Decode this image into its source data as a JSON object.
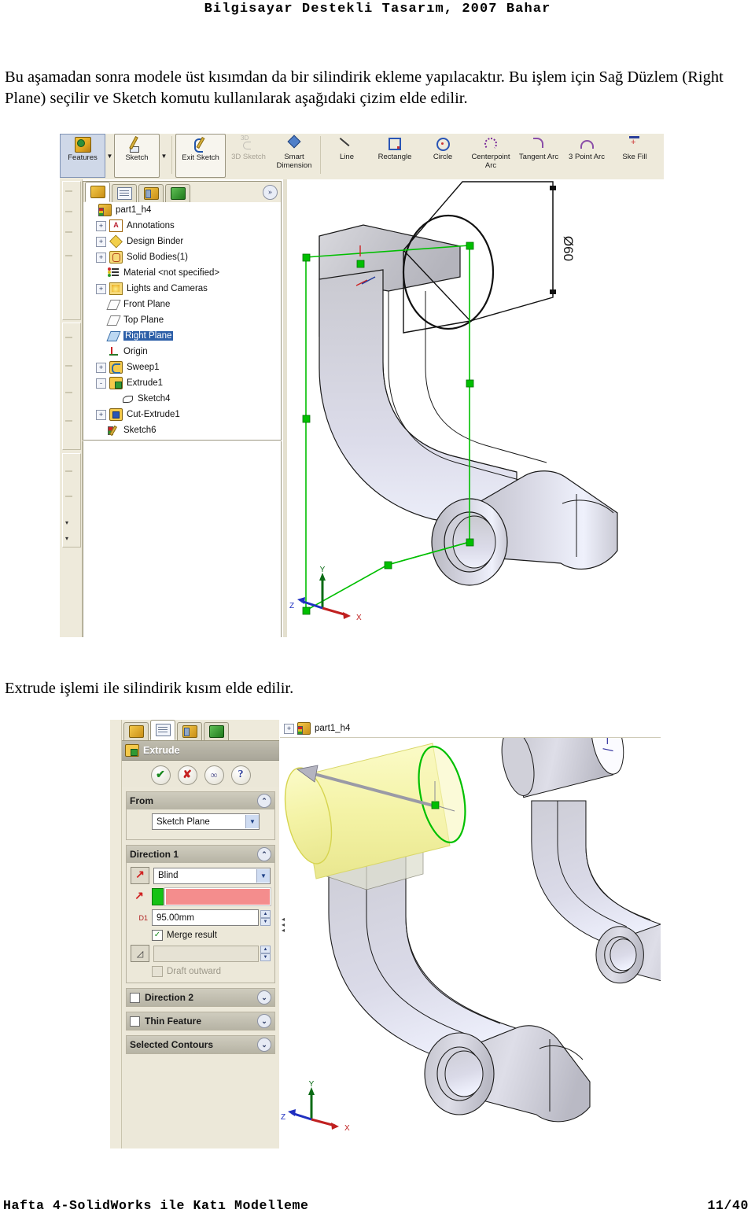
{
  "document": {
    "header": "Bilgisayar Destekli Tasarım, 2007 Bahar",
    "paragraph1": "Bu aşamadan sonra modele üst kısımdan da bir silindirik ekleme yapılacaktır. Bu işlem için Sağ Düzlem (Right Plane) seçilir ve Sketch komutu kullanılarak aşağıdaki çizim elde edilir.",
    "paragraph2": "Extrude işlemi ile silindirik kısım elde edilir.",
    "footer_left": "Hafta 4-SolidWorks ile Katı Modelleme",
    "footer_right": "11/40"
  },
  "screenshot1": {
    "toolbar": [
      {
        "label": "Features",
        "icon": "features-icon",
        "has_dropdown": true,
        "state": "active"
      },
      {
        "label": "Sketch",
        "icon": "sketch-icon",
        "has_dropdown": true,
        "state": "framed"
      },
      {
        "label": "Exit Sketch",
        "icon": "exit-sketch-icon",
        "state": "framed"
      },
      {
        "label": "3D Sketch",
        "icon": "3d-sketch-icon",
        "state": "disabled"
      },
      {
        "label": "Smart Dimension",
        "icon": "smart-dimension-icon",
        "state": "normal"
      },
      {
        "label": "Line",
        "icon": "line-icon",
        "state": "normal"
      },
      {
        "label": "Rectangle",
        "icon": "rectangle-icon",
        "state": "normal"
      },
      {
        "label": "Circle",
        "icon": "circle-icon",
        "state": "normal"
      },
      {
        "label": "Centerpoint Arc",
        "icon": "centerpoint-arc-icon",
        "state": "normal"
      },
      {
        "label": "Tangent Arc",
        "icon": "tangent-arc-icon",
        "state": "normal"
      },
      {
        "label": "3 Point Arc",
        "icon": "3-point-arc-icon",
        "state": "normal"
      },
      {
        "label": "Ske Fill",
        "icon": "sketch-fillet-icon",
        "state": "clipped"
      }
    ],
    "tree_tabs": [
      {
        "name": "feature-manager-tab",
        "icon": "feature-tree-icon",
        "selected": true
      },
      {
        "name": "property-manager-tab",
        "icon": "property-clipboard-icon",
        "selected": false
      },
      {
        "name": "configuration-manager-tab",
        "icon": "configuration-icon",
        "selected": false
      },
      {
        "name": "display-manager-tab",
        "icon": "render-cube-icon",
        "selected": false
      }
    ],
    "tree_more_glyph": "»",
    "tree": [
      {
        "label": "part1_h4",
        "icon": "part-icon",
        "indent": 0,
        "expander": "none",
        "selected": false
      },
      {
        "label": "Annotations",
        "icon": "annotations-icon",
        "indent": 1,
        "expander": "+",
        "selected": false
      },
      {
        "label": "Design Binder",
        "icon": "design-binder-icon",
        "indent": 1,
        "expander": "+",
        "selected": false
      },
      {
        "label": "Solid Bodies(1)",
        "icon": "solid-bodies-icon",
        "indent": 1,
        "expander": "+",
        "selected": false
      },
      {
        "label": "Material <not specified>",
        "icon": "material-icon",
        "indent": 1,
        "expander": "none",
        "selected": false
      },
      {
        "label": "Lights and Cameras",
        "icon": "lights-cameras-icon",
        "indent": 1,
        "expander": "+",
        "selected": false
      },
      {
        "label": "Front Plane",
        "icon": "plane-icon",
        "indent": 1,
        "expander": "none",
        "selected": false
      },
      {
        "label": "Top Plane",
        "icon": "plane-icon",
        "indent": 1,
        "expander": "none",
        "selected": false
      },
      {
        "label": "Right Plane",
        "icon": "plane-icon",
        "indent": 1,
        "expander": "none",
        "selected": true
      },
      {
        "label": "Origin",
        "icon": "origin-icon",
        "indent": 1,
        "expander": "none",
        "selected": false
      },
      {
        "label": "Sweep1",
        "icon": "sweep-icon",
        "indent": 1,
        "expander": "+",
        "selected": false
      },
      {
        "label": "Extrude1",
        "icon": "extrude-icon",
        "indent": 1,
        "expander": "-",
        "selected": false
      },
      {
        "label": "Sketch4",
        "icon": "sketch-icon",
        "indent": 2,
        "expander": "none",
        "selected": false
      },
      {
        "label": "Cut-Extrude1",
        "icon": "cut-extrude-icon",
        "indent": 1,
        "expander": "+",
        "selected": false
      },
      {
        "label": "Sketch6",
        "icon": "sketch-active-icon",
        "indent": 1,
        "expander": "none",
        "selected": false
      }
    ],
    "viewport": {
      "dimension_label": "Ø60",
      "triad": {
        "x": "X",
        "y": "Y",
        "z": "Z"
      }
    }
  },
  "screenshot2": {
    "property_manager": {
      "title": "Extrude",
      "title_icon": "extrude-icon",
      "tabs": [
        {
          "name": "feature-manager-tab",
          "icon": "feature-tree-icon",
          "selected": false
        },
        {
          "name": "property-manager-tab",
          "icon": "property-clipboard-icon",
          "selected": true
        },
        {
          "name": "configuration-manager-tab",
          "icon": "configuration-icon",
          "selected": false
        },
        {
          "name": "display-manager-tab",
          "icon": "render-cube-icon",
          "selected": false
        }
      ],
      "action_buttons": [
        {
          "name": "ok-button",
          "glyph": "✔"
        },
        {
          "name": "cancel-button",
          "glyph": "✘"
        },
        {
          "name": "preview-button",
          "glyph": "∞"
        },
        {
          "name": "help-button",
          "glyph": "?"
        }
      ],
      "sections": [
        {
          "name": "from-section",
          "title": "From",
          "collapse_glyph": "⌃",
          "start_condition": "Sketch Plane"
        },
        {
          "name": "direction1-section",
          "title": "Direction 1",
          "collapse_glyph": "⌃",
          "end_condition": "Blind",
          "depth_label": "D1",
          "depth_value": "95.00mm",
          "merge_result_label": "Merge result",
          "merge_result_checked": true,
          "draft_label": "Draft outward",
          "draft_checked": false,
          "draft_enabled": false
        },
        {
          "name": "direction2-section",
          "title": "Direction 2",
          "checkbox": true,
          "checked": false,
          "collapse_glyph": "⌄"
        },
        {
          "name": "thin-feature-section",
          "title": "Thin Feature",
          "checkbox": true,
          "checked": false,
          "collapse_glyph": "⌄"
        },
        {
          "name": "selected-contours-section",
          "title": "Selected Contours",
          "checkbox": false,
          "collapse_glyph": "⌄"
        }
      ]
    },
    "viewport": {
      "tree_root": "part1_h4",
      "tree_root_expander": "+",
      "triad": {
        "x": "X",
        "y": "Y",
        "z": "Z"
      }
    }
  },
  "colors": {
    "toolbar_bg": "#eeeadb",
    "panel_bg": "#ece8d9",
    "selection_blue": "#2d5fa8",
    "preview_yellow": "#f2efa8",
    "sketch_green": "#00c000",
    "depth_field_red": "#f48d8d",
    "depth_bar_green": "#15c215"
  }
}
